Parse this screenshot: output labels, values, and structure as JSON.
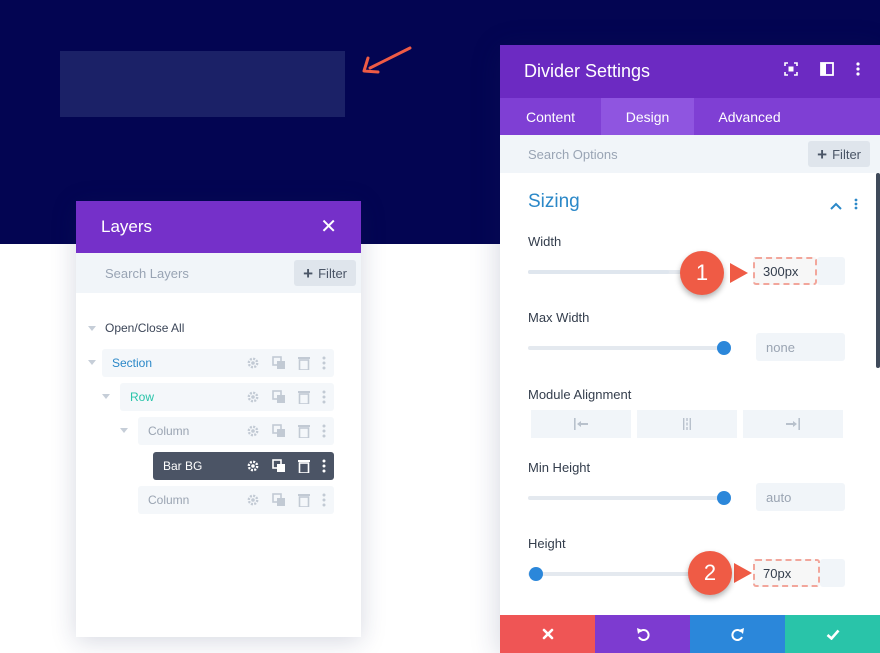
{
  "layers_panel": {
    "title": "Layers",
    "search_placeholder": "Search Layers",
    "filter_label": "Filter",
    "toggle_all": "Open/Close All",
    "items": [
      {
        "label": "Section"
      },
      {
        "label": "Row"
      },
      {
        "label": "Column"
      },
      {
        "label": "Bar BG"
      },
      {
        "label": "Column"
      }
    ]
  },
  "settings_panel": {
    "title": "Divider Settings",
    "tabs": [
      {
        "label": "Content"
      },
      {
        "label": "Design"
      },
      {
        "label": "Advanced"
      }
    ],
    "active_tab": "Design",
    "search_placeholder": "Search Options",
    "filter_label": "Filter",
    "section_title": "Sizing",
    "fields": {
      "width": {
        "label": "Width",
        "value": "300px",
        "slider_percent": 72
      },
      "max_width": {
        "label": "Max Width",
        "value": "none",
        "slider_percent": 100
      },
      "module_alignment": {
        "label": "Module Alignment"
      },
      "min_height": {
        "label": "Min Height",
        "value": "auto",
        "slider_percent": 100
      },
      "height": {
        "label": "Height",
        "value": "70px",
        "slider_percent": 4
      }
    }
  },
  "annotations": {
    "badge_1": "1",
    "badge_2": "2"
  },
  "colors": {
    "hero_bg": "#030552",
    "bar_bg": "#1b2167",
    "panel_header": "#6c2ac2",
    "accent_blue": "#2b87da",
    "cancel": "#ef5555",
    "undo": "#7d3bd0",
    "redo": "#2b87da",
    "save": "#29c4a9",
    "badge": "#ef5b45"
  }
}
